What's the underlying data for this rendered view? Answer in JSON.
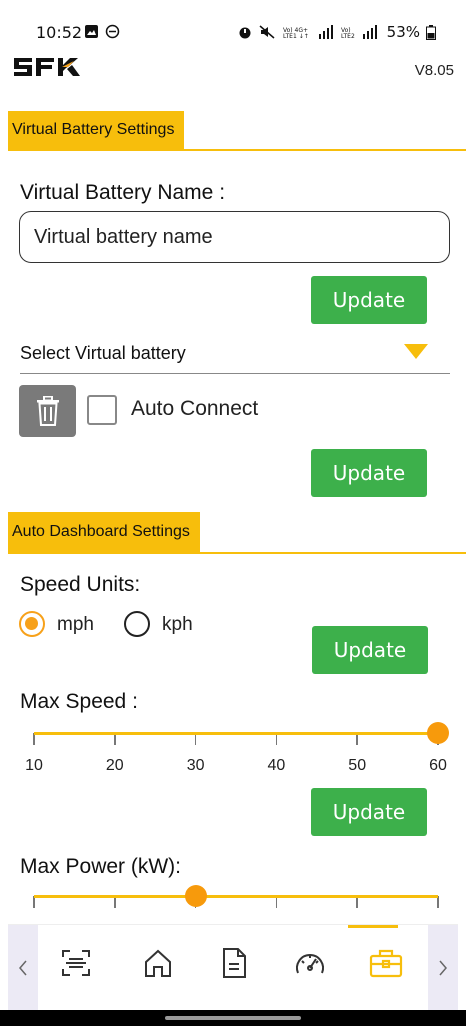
{
  "status_bar": {
    "time": "10:52",
    "battery": "53%"
  },
  "header": {
    "version": "V8.05"
  },
  "virtual_battery": {
    "section_title": "Virtual Battery Settings",
    "name_label": "Virtual Battery Name :",
    "name_placeholder": "Virtual battery name",
    "update_label": "Update",
    "select_label": "Select Virtual battery",
    "auto_connect_label": "Auto Connect",
    "auto_connect_checked": false,
    "update2_label": "Update"
  },
  "auto_dashboard": {
    "section_title": "Auto Dashboard Settings",
    "speed_units_label": "Speed Units:",
    "speed_units_options": [
      "mph",
      "kph"
    ],
    "speed_units_selected": "mph",
    "update_label": "Update",
    "max_speed_label": "Max Speed :",
    "max_speed_ticks": [
      "10",
      "20",
      "30",
      "40",
      "50",
      "60"
    ],
    "max_speed_value": 60,
    "update2_label": "Update",
    "max_power_label": "Max Power (kW):",
    "max_power_value_fraction": 0.4
  },
  "bottom_nav": {
    "items": [
      "scan-icon",
      "home-icon",
      "document-icon",
      "speedometer-icon",
      "toolbox-icon"
    ],
    "active": "toolbox-icon"
  },
  "colors": {
    "accent": "#f7be0c",
    "button": "#3db04b",
    "thumb": "#f79a0c"
  }
}
